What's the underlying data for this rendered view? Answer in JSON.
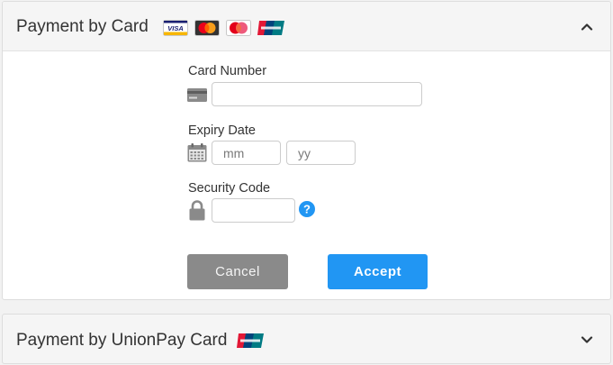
{
  "card_panel": {
    "title": "Payment by Card",
    "logos": [
      "visa-logo",
      "mastercard-logo",
      "maestro-logo",
      "unionpay-logo"
    ],
    "collapse_icon": "chevron-up-icon",
    "card_number": {
      "label": "Card Number",
      "value": "",
      "placeholder": "",
      "icon": "credit-card-icon"
    },
    "expiry": {
      "label": "Expiry Date",
      "icon": "calendar-icon",
      "month_placeholder": "mm",
      "year_placeholder": "yy",
      "month_value": "",
      "year_value": ""
    },
    "security": {
      "label": "Security Code",
      "icon": "lock-icon",
      "value": "",
      "help_icon": "question-circle-icon"
    },
    "cancel_label": "Cancel",
    "accept_label": "Accept"
  },
  "unionpay_panel": {
    "title": "Payment by UnionPay Card",
    "logo": "unionpay-logo",
    "expand_icon": "chevron-down-icon"
  },
  "colors": {
    "accent": "#2196f3",
    "cancel": "#8a8a8a",
    "help": "#2196f3",
    "visa_blue": "#1a1f71",
    "mastercard_red": "#eb001b",
    "mastercard_yellow": "#f79e1b",
    "unionpay_red": "#e21836",
    "unionpay_blue": "#00447c",
    "unionpay_teal": "#007b84"
  }
}
